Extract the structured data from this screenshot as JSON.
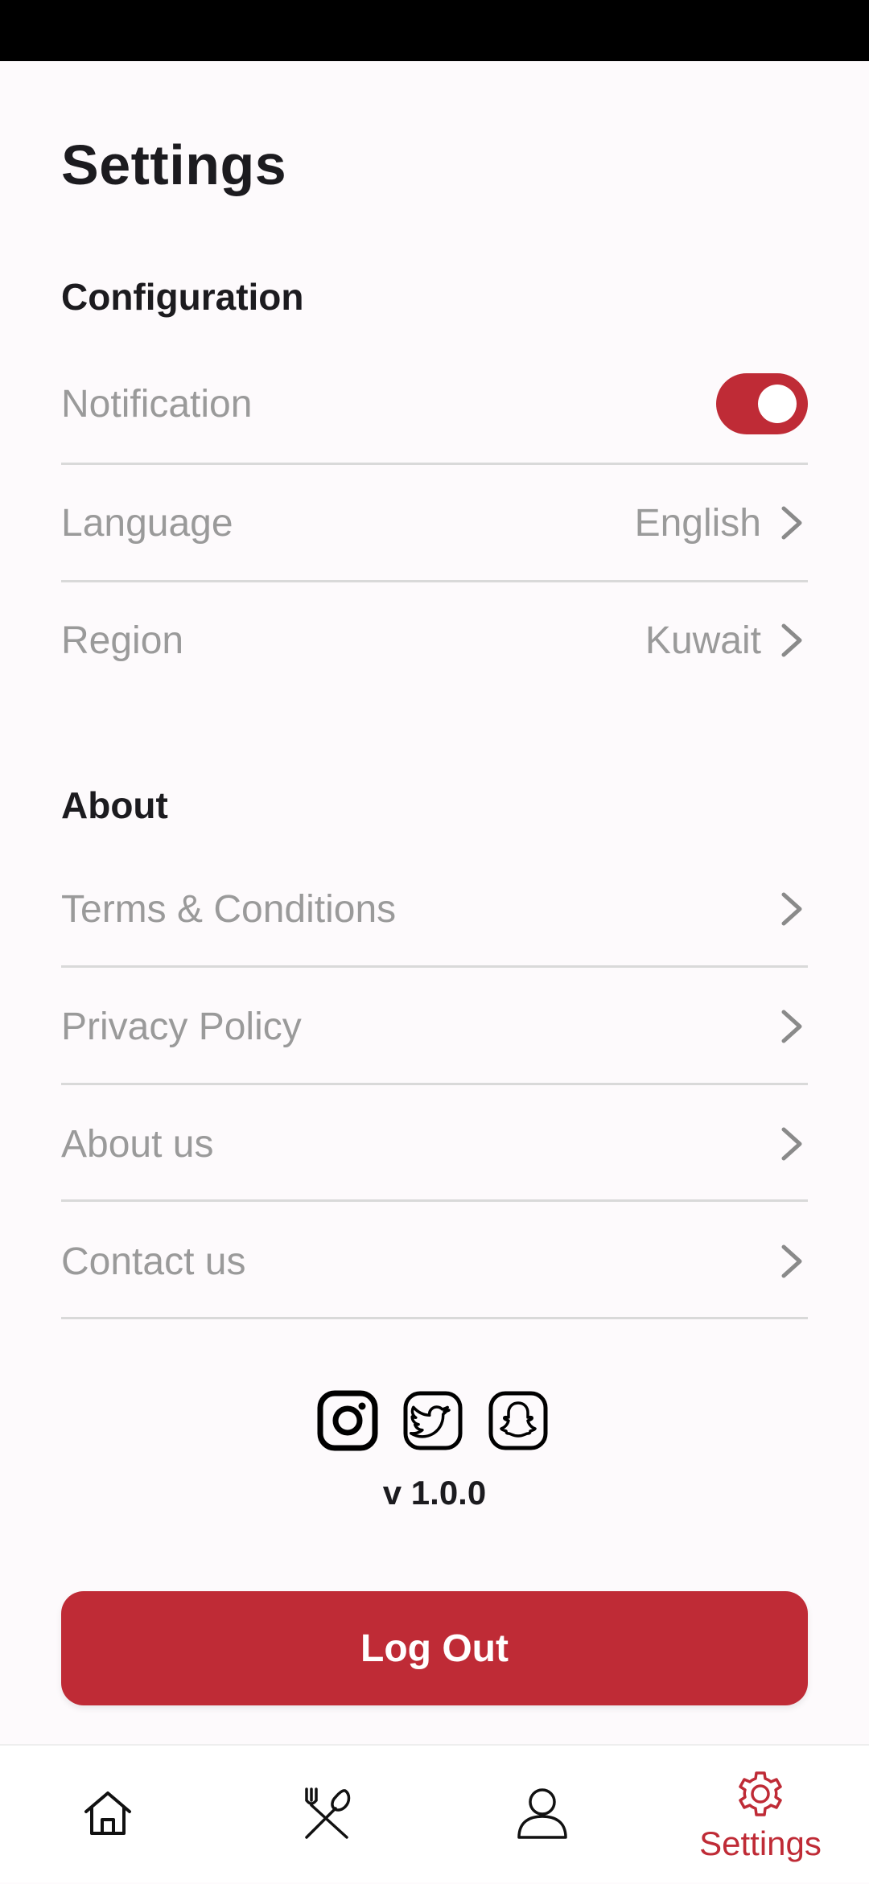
{
  "page": {
    "title": "Settings"
  },
  "colors": {
    "accent": "#bf2b36",
    "muted_text": "#9a9a9a",
    "divider": "#d9d9d9"
  },
  "configuration": {
    "title": "Configuration",
    "notification": {
      "label": "Notification",
      "enabled": true
    },
    "language": {
      "label": "Language",
      "value": "English"
    },
    "region": {
      "label": "Region",
      "value": "Kuwait"
    }
  },
  "about": {
    "title": "About",
    "items": [
      {
        "label": "Terms & Conditions"
      },
      {
        "label": "Privacy Policy"
      },
      {
        "label": "About us"
      },
      {
        "label": "Contact us"
      }
    ]
  },
  "social": [
    "instagram-icon",
    "twitter-icon",
    "snapchat-icon"
  ],
  "version": "v 1.0.0",
  "logout_label": "Log Out",
  "bottom_nav": {
    "items": [
      {
        "icon": "home-icon"
      },
      {
        "icon": "fork-knife-icon"
      },
      {
        "icon": "profile-icon"
      },
      {
        "icon": "gear-icon",
        "label": "Settings",
        "active": true
      }
    ]
  }
}
